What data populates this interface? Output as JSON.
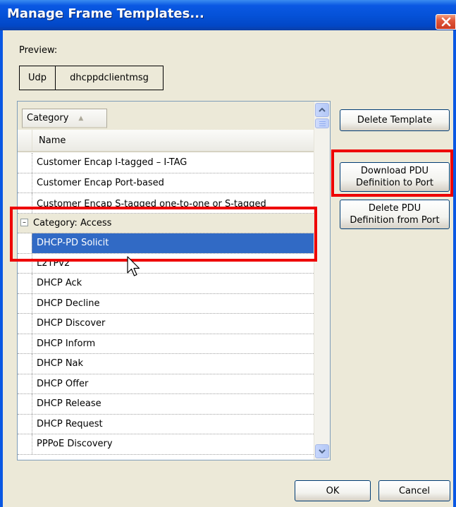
{
  "dialog": {
    "title": "Manage Frame Templates...",
    "close_glyph": "✕"
  },
  "preview": {
    "label": "Preview:",
    "fields": [
      "Udp",
      "dhcppdclientmsg"
    ]
  },
  "grid": {
    "group_by_header": "Category",
    "sort_glyph": "▲",
    "column_header": "Name",
    "rows": [
      {
        "text": "Customer Encap I-tagged – I-TAG"
      },
      {
        "text": "Customer Encap Port-based"
      },
      {
        "text": "Customer Encap S-tagged one-to-one or S-tagged"
      },
      {
        "text": "Category: Access",
        "collapse_glyph": "–"
      },
      {
        "text": "DHCP-PD Solicit"
      },
      {
        "text": "L2TPv2"
      },
      {
        "text": "DHCP Ack"
      },
      {
        "text": "DHCP Decline"
      },
      {
        "text": "DHCP Discover"
      },
      {
        "text": "DHCP Inform"
      },
      {
        "text": "DHCP Nak"
      },
      {
        "text": "DHCP Offer"
      },
      {
        "text": "DHCP Release"
      },
      {
        "text": "DHCP Request"
      },
      {
        "text": "PPPoE Discovery"
      }
    ],
    "selected_row": "DHCP-PD Solicit"
  },
  "side_buttons": {
    "delete_template": "Delete Template",
    "download_pdu_line1": "Download PDU",
    "download_pdu_line2": "Definition to Port",
    "delete_pdu_line1": "Delete PDU",
    "delete_pdu_line2": "Definition from Port"
  },
  "footer": {
    "ok": "OK",
    "cancel": "Cancel"
  },
  "colors": {
    "title_bar": "#0552d8",
    "selection": "#316ac5",
    "highlight": "#ee0000",
    "dialog_bg": "#ece9d8"
  },
  "icons": {
    "close": "close-icon",
    "scroll_up": "chevron-up-icon",
    "scroll_down": "chevron-down-icon",
    "cursor": "mouse-pointer-icon",
    "collapse": "collapse-minus-icon"
  }
}
